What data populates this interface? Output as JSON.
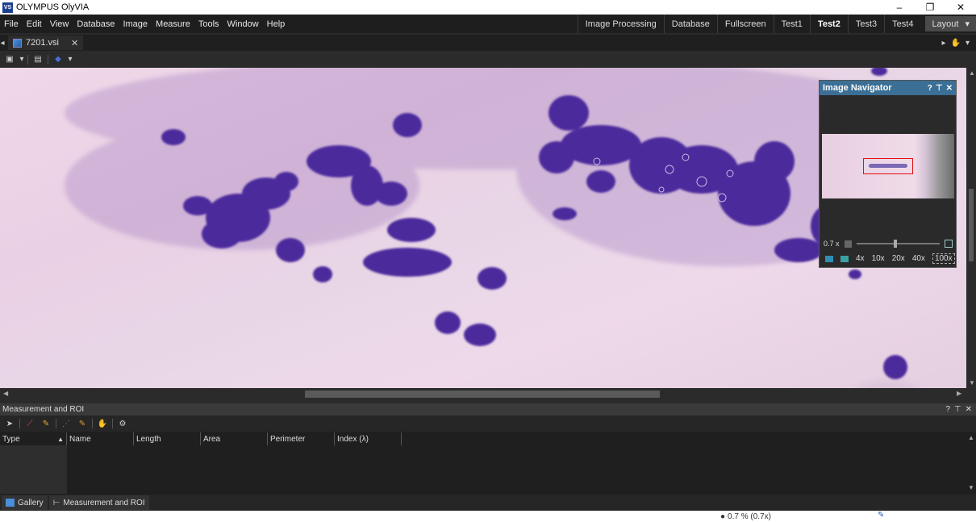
{
  "window": {
    "title": "OLYMPUS OlyVIA",
    "logo_text": "VS",
    "minimize": "–",
    "maximize": "❐",
    "close": "✕"
  },
  "menus": [
    "File",
    "Edit",
    "View",
    "Database",
    "Image",
    "Measure",
    "Tools",
    "Window",
    "Help"
  ],
  "view_tabs": [
    "Image Processing",
    "Database",
    "Fullscreen",
    "Test1",
    "Test2",
    "Test3",
    "Test4"
  ],
  "active_view_tab": "Test2",
  "layout_label": "Layout",
  "document_tab": {
    "name": "7201.vsi",
    "close": "✕"
  },
  "navigator": {
    "title": "Image Navigator",
    "help": "?",
    "pin": "⊤",
    "close": "✕",
    "zoom_value": "0.7 x",
    "magnifications": [
      "4x",
      "10x",
      "20x",
      "40x",
      "100x"
    ],
    "selected_magnification": "100x"
  },
  "measurement_panel": {
    "title": "Measurement and ROI",
    "help": "?",
    "pin": "⊤",
    "close": "✕",
    "columns": [
      "Type",
      "Name",
      "Length",
      "Area",
      "Perimeter",
      "Index (λ)"
    ]
  },
  "bottom_tabs": [
    "Gallery",
    "Measurement and ROI"
  ],
  "status": {
    "zoom": "0.7 % (0.7x)"
  },
  "colors": {
    "stain": "#4b2a9c",
    "background": "#ecd6e6",
    "nav_header": "#3b6f96"
  }
}
